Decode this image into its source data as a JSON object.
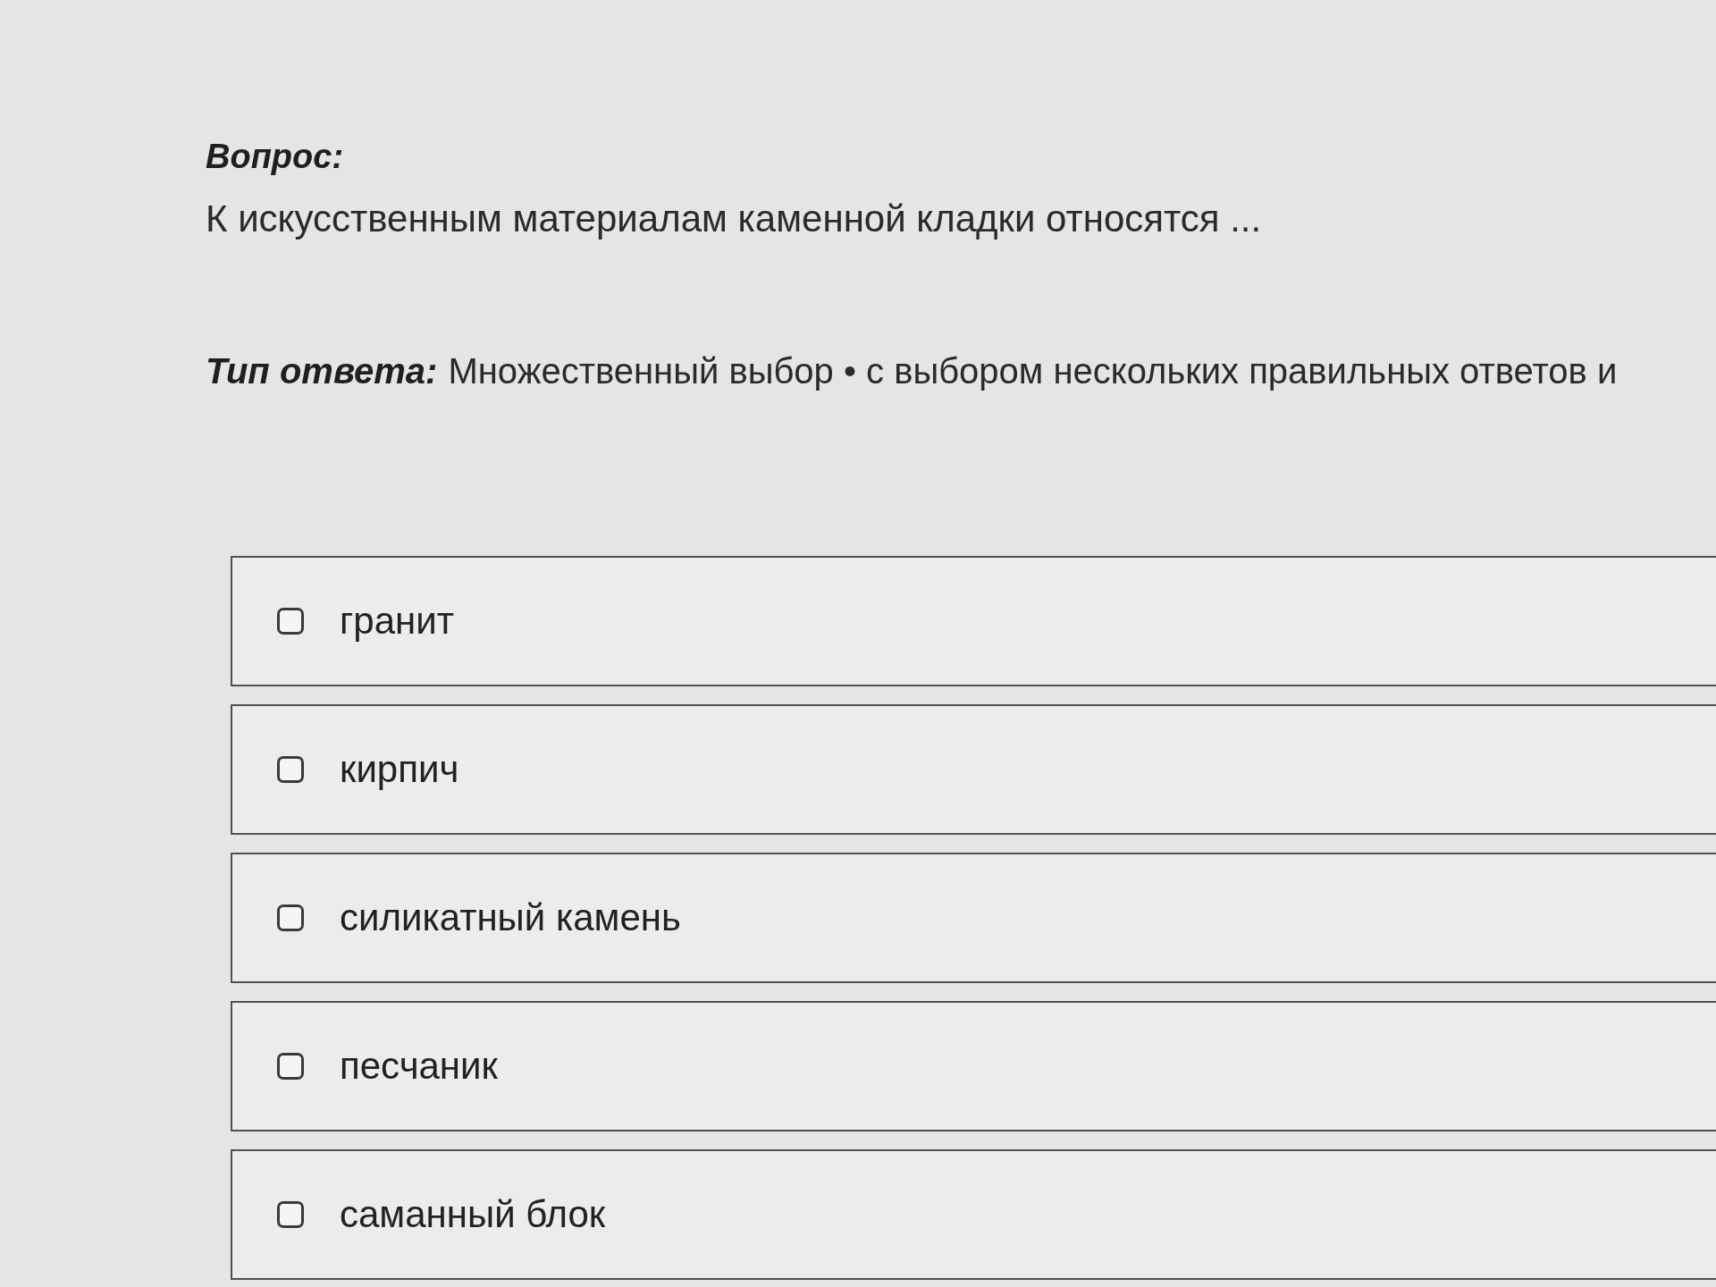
{
  "question": {
    "label": "Вопрос:",
    "text": "К искусственным материалам каменной кладки относятся ..."
  },
  "answer_type": {
    "label": "Тип ответа:",
    "text": "Множественный выбор • с выбором нескольких правильных ответов и"
  },
  "options": [
    {
      "label": "гранит",
      "checked": false
    },
    {
      "label": "кирпич",
      "checked": false
    },
    {
      "label": "силикатный камень",
      "checked": false
    },
    {
      "label": "песчаник",
      "checked": false
    },
    {
      "label": "саманный блок",
      "checked": false
    }
  ]
}
